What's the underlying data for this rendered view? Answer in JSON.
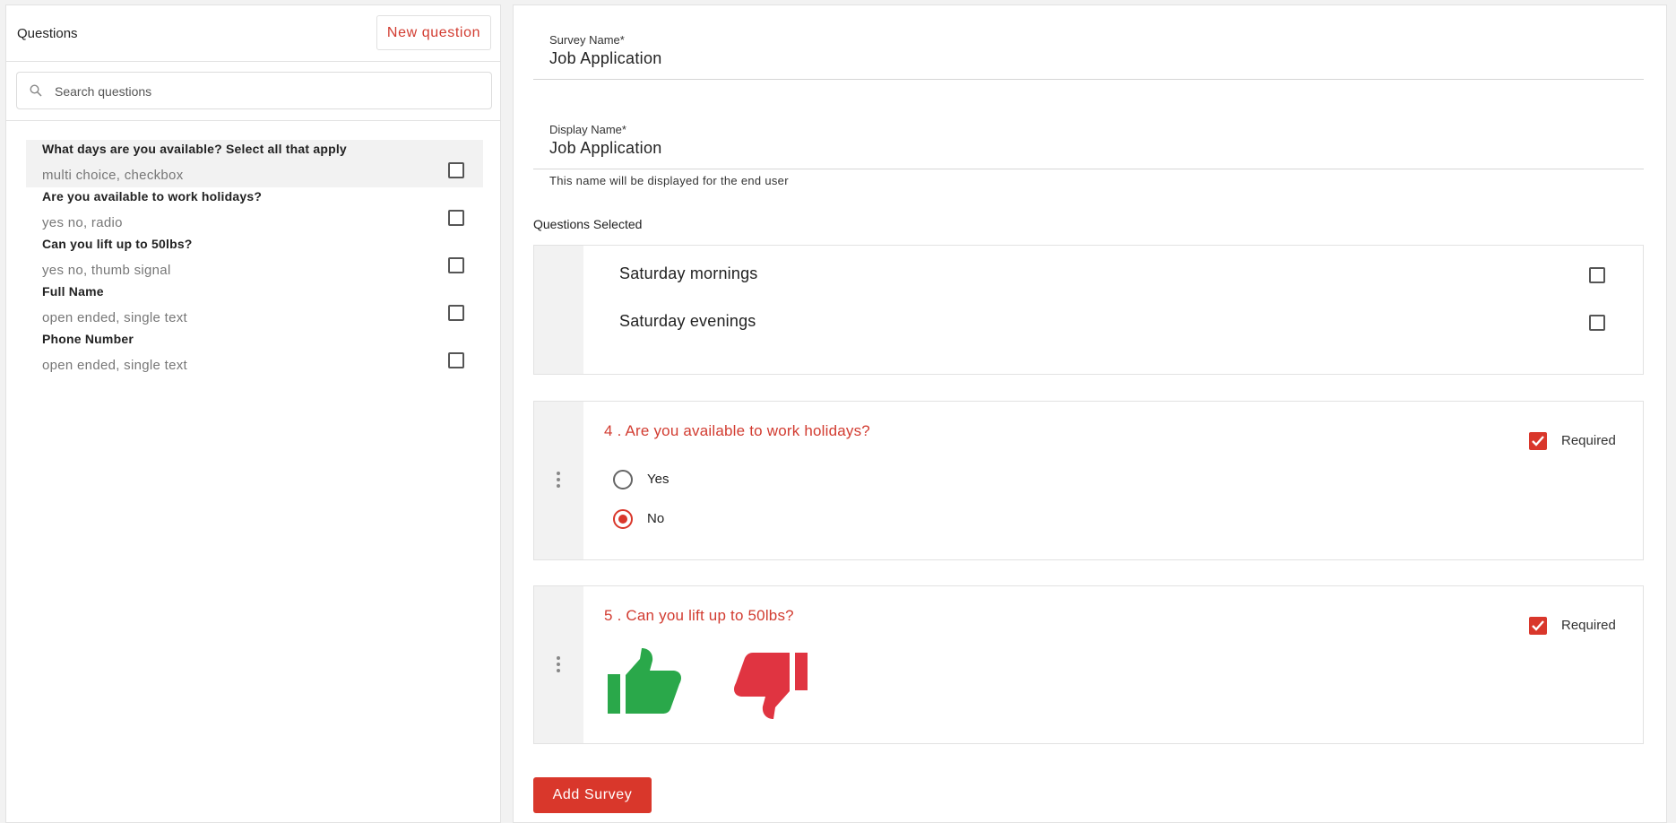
{
  "sidebar": {
    "title": "Questions",
    "new_question_label": "New question",
    "search_placeholder": "Search questions",
    "questions": [
      {
        "title": "What days are you available? Select all that apply",
        "subtitle": "multi choice, checkbox",
        "checked": false,
        "highlighted": true
      },
      {
        "title": "Are you available to work holidays?",
        "subtitle": "yes no, radio",
        "checked": false,
        "highlighted": false
      },
      {
        "title": "Can you lift up to 50lbs?",
        "subtitle": "yes no, thumb signal",
        "checked": false,
        "highlighted": false
      },
      {
        "title": "Full Name",
        "subtitle": "open ended, single text",
        "checked": false,
        "highlighted": false
      },
      {
        "title": "Phone Number",
        "subtitle": "open ended, single text",
        "checked": false,
        "highlighted": false
      }
    ]
  },
  "form": {
    "survey_name_label": "Survey Name*",
    "survey_name_value": "Job Application",
    "display_name_label": "Display Name*",
    "display_name_value": "Job Application",
    "display_name_helper": "This name will be displayed for the end user",
    "questions_selected_label": "Questions Selected"
  },
  "selected": {
    "card1": {
      "options": [
        {
          "label": "Saturday mornings",
          "checked": false
        },
        {
          "label": "Saturday evenings",
          "checked": false
        }
      ]
    },
    "card2": {
      "title": "4 . Are you available to work holidays?",
      "required_label": "Required",
      "required": true,
      "options": [
        {
          "label": "Yes",
          "selected": false
        },
        {
          "label": "No",
          "selected": true
        }
      ]
    },
    "card3": {
      "title": "5 . Can you lift up to 50lbs?",
      "required_label": "Required",
      "required": true,
      "thumb_up_icon": "thumbs-up-icon",
      "thumb_down_icon": "thumbs-down-icon",
      "thumb_up_color": "#2aa84a",
      "thumb_down_color": "#e03441"
    }
  },
  "add_survey_label": "Add Survey",
  "colors": {
    "accent": "#d9372b",
    "accent_text": "#d23c31",
    "panel_bg": "#f2f2f2"
  }
}
